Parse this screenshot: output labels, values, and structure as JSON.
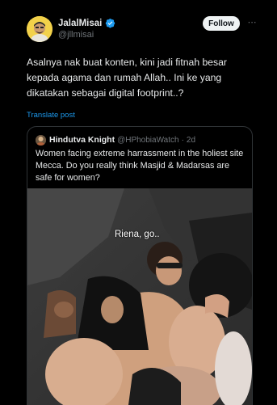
{
  "post": {
    "display_name": "JalalMisai",
    "handle": "@jllmisai",
    "follow_label": "Follow",
    "more_label": "⋯",
    "text": "Asalnya nak buat konten, kini jadi fitnah besar kepada agama dan rumah Allah.. Ini ke yang dikatakan sebagai digital footprint..?",
    "translate_label": "Translate post"
  },
  "quote": {
    "display_name": "Hindutva Knight",
    "handle": "@HPhobiaWatch",
    "separator": "·",
    "age": "2d",
    "text": "Women facing extreme harrassment in the holiest site Mecca. Do you really think Masjid & Madarsas are safe for women?",
    "media_caption": "Riena, go.."
  },
  "colors": {
    "background": "#000000",
    "accent": "#1d9bf0",
    "text_primary": "#e7e9ea",
    "text_secondary": "#71767b"
  },
  "icons": {
    "verified": "verified-badge-icon",
    "more": "more-options-icon"
  }
}
